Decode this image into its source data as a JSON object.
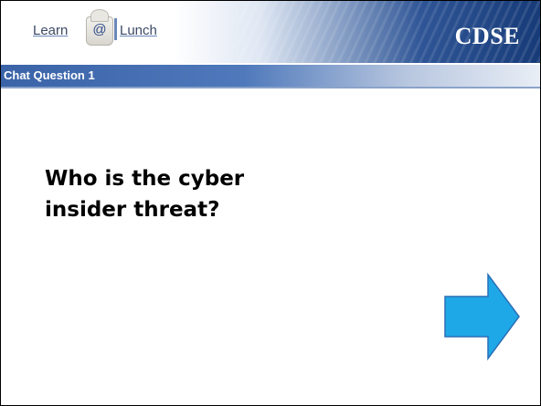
{
  "header": {
    "logo_learn": "Learn",
    "logo_at": "@",
    "logo_lunch": "Lunch",
    "brand": "CDSE"
  },
  "slide": {
    "section_title": "Chat Question 1",
    "question_line1": "Who is the cyber",
    "question_line2": "insider threat?"
  },
  "next_arrow": {
    "icon": "right-arrow-icon",
    "fill_color": "#1fa8e8",
    "stroke_color": "#2a6fb5"
  },
  "colors": {
    "title_bar": "#3a63a8",
    "header_dark": "#173b78"
  }
}
